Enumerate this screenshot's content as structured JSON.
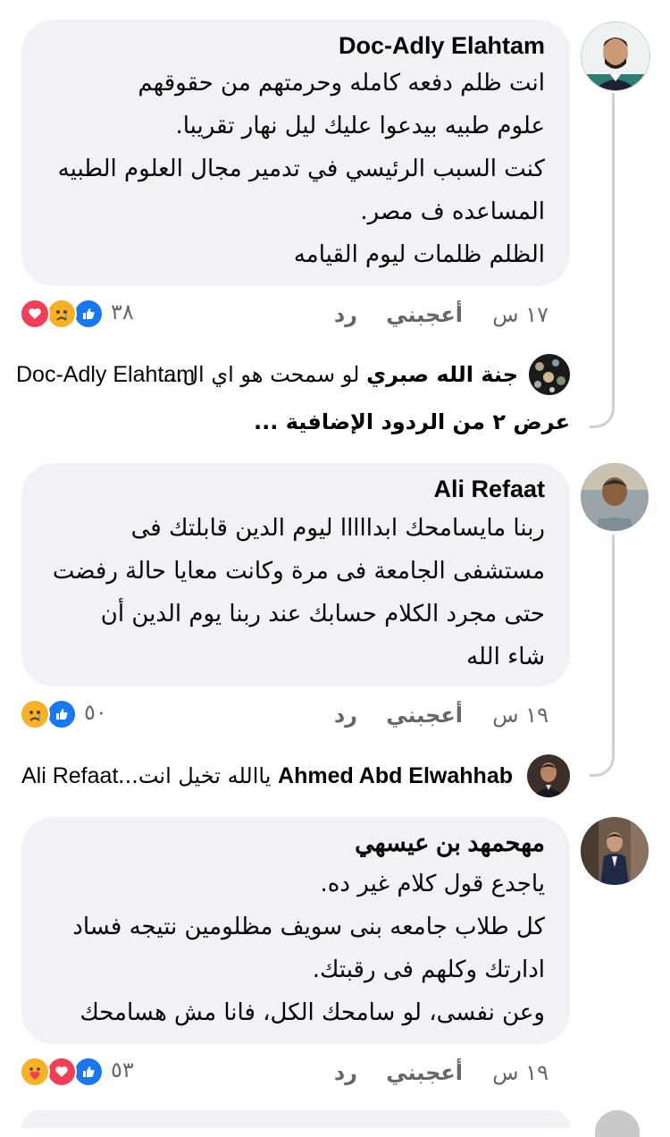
{
  "comments": [
    {
      "author": "Doc-Adly Elahtam",
      "lines": [
        "انت ظلم دفعه كامله وحرمتهم من حقوقهم",
        "علوم طبيه بيدعوا عليك ليل نهار تقريبا.",
        "كنت السبب الرئيسي في تدمير مجال العلوم الطبيه",
        "المساعده ف مصر.",
        "الظلم ظلمات ليوم القيامه"
      ],
      "time": "١٧ س",
      "like_label": "أعجبني",
      "reply_label": "رد",
      "reaction_count": "٣٨",
      "reaction_icons": [
        "love-icon",
        "sad-icon",
        "like-icon"
      ],
      "reply_preview": {
        "name": "جنة الله صبري",
        "snippet": "لو سمحت هو اي ال...",
        "mention": "Doc-Adly Elahtam"
      },
      "more_replies": "عرض ٢ من الردود الإضافية ..."
    },
    {
      "author": "Ali Refaat",
      "lines": [
        "ربنا مايسامحك ابدااااا ليوم الدين قابلتك فى",
        "مستشفى الجامعة فى مرة وكانت معايا حالة رفضت",
        "حتى مجرد الكلام حسابك عند ربنا يوم الدين أن",
        "شاء الله"
      ],
      "time": "١٩ س",
      "like_label": "أعجبني",
      "reply_label": "رد",
      "reaction_count": "٥٠",
      "reaction_icons": [
        "sad-icon",
        "like-icon"
      ],
      "reply_preview": {
        "name": "Ahmed Abd Elwahhab",
        "snippet": "ياالله تخيل انت...",
        "mention": "Ali Refaat"
      }
    },
    {
      "author": "مهحمهد بن عيسهي",
      "lines": [
        "ياجدع قول كلام غير ده.",
        "كل طلاب جامعه بنى سويف مظلومين نتيجه فساد",
        "ادارتك وكلهم فى رقبتك.",
        "وعن نفسى، لو سامحك الكل، فانا مش هسامحك"
      ],
      "time": "١٩ س",
      "like_label": "أعجبني",
      "reply_label": "رد",
      "reaction_count": "٥٣",
      "reaction_icons": [
        "care-icon",
        "love-icon",
        "like-icon"
      ]
    }
  ],
  "colors": {
    "bubble": "#f0f2f5",
    "meta": "#65676b",
    "like": "#1877f2",
    "love": "#f33e58",
    "sad": "#f7b125",
    "thread": "#ced0d4"
  }
}
